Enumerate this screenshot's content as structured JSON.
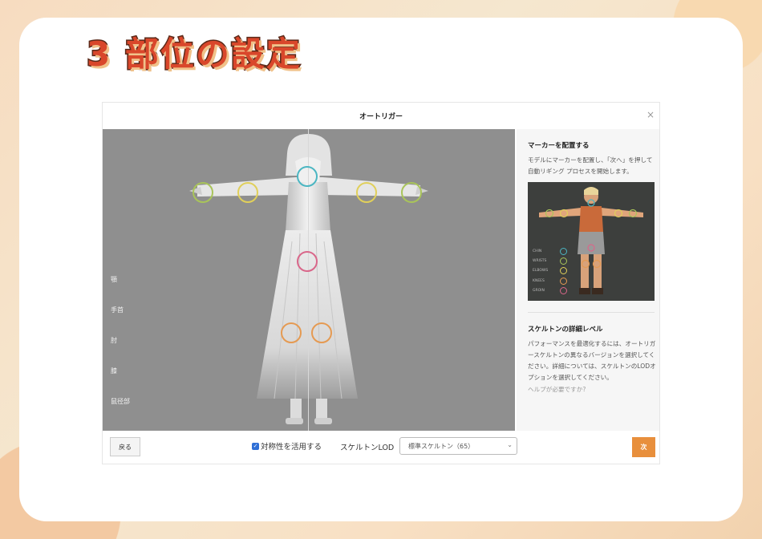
{
  "page": {
    "title": "3 部位の設定"
  },
  "dialog": {
    "title": "オートリガー",
    "close_icon": "×",
    "side_labels": [
      "顎",
      "手首",
      "肘",
      "膝",
      "鼠径部"
    ],
    "panel": {
      "marker_title": "マーカーを配置する",
      "marker_text": "モデルにマーカーを配置し、「次へ」を押して自動リギング プロセスを開始します。",
      "legend": [
        "CHIN",
        "WRISTS",
        "ELBOWS",
        "KNEES",
        "GROIN"
      ],
      "lod_title": "スケルトンの詳細レベル",
      "lod_text": "パフォーマンスを最適化するには、オートリガースケルトンの異なるバージョンを選択してください。詳細については、スケルトンのLODオプションを選択してください。",
      "help_link": "ヘルプが必要ですか?"
    },
    "footer": {
      "back_label": "戻る",
      "symmetry_label": "対称性を活用する",
      "symmetry_checked": true,
      "lod_label": "スケルトンLOD",
      "lod_selected": "標準スケルトン（65）",
      "next_label": "次"
    }
  },
  "colors": {
    "chin": "#4bb6c2",
    "wrists": "#a9c45a",
    "elbows": "#e0cf5a",
    "knees": "#e59a52",
    "groin": "#d9678a",
    "accent": "#e88f3c"
  }
}
